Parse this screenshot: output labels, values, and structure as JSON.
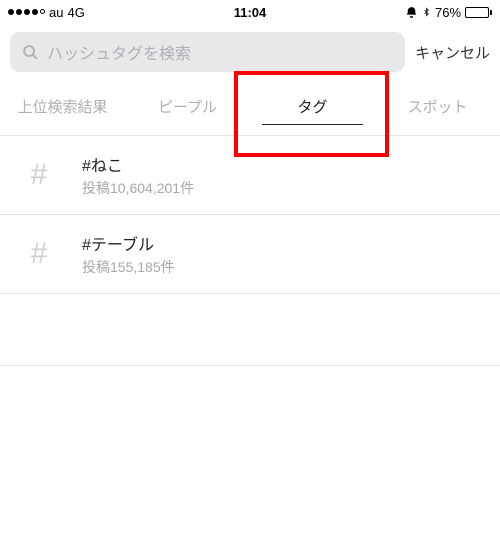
{
  "status_bar": {
    "carrier": "au",
    "network": "4G",
    "time": "11:04",
    "battery_percent": "76%"
  },
  "search": {
    "placeholder": "ハッシュタグを検索",
    "cancel_label": "キャンセル"
  },
  "tabs": {
    "top": "上位検索結果",
    "people": "ピープル",
    "tags": "タグ",
    "spots": "スポット"
  },
  "results": [
    {
      "title": "#ねこ",
      "subtitle": "投稿10,604,201件"
    },
    {
      "title": "#テーブル",
      "subtitle": "投稿155,185件"
    }
  ]
}
